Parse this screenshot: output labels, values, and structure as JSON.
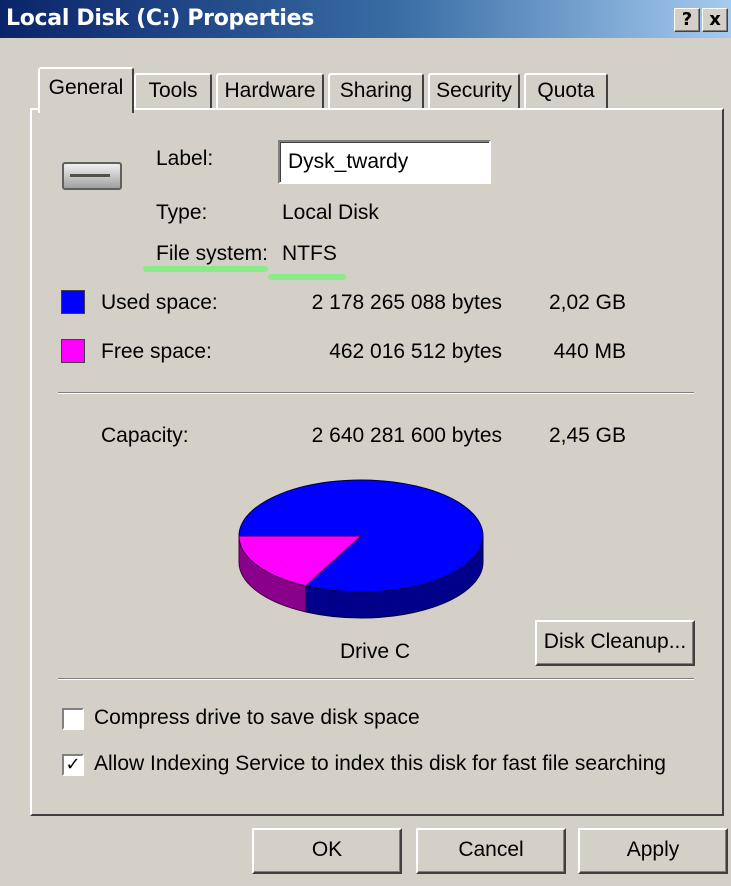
{
  "window": {
    "title": "Local Disk (C:) Properties",
    "help_label": "?",
    "close_label": "x"
  },
  "tabs": [
    {
      "label": "General",
      "active": true
    },
    {
      "label": "Tools"
    },
    {
      "label": "Hardware"
    },
    {
      "label": "Sharing"
    },
    {
      "label": "Security"
    },
    {
      "label": "Quota"
    }
  ],
  "general": {
    "label_caption": "Label:",
    "label_value": "Dysk_twardy",
    "type_caption": "Type:",
    "type_value": "Local Disk",
    "fs_caption": "File system:",
    "fs_value": "NTFS",
    "used_caption": "Used space:",
    "used_bytes": "2 178 265 088 bytes",
    "used_size": "2,02 GB",
    "free_caption": "Free space:",
    "free_bytes": "462 016 512 bytes",
    "free_size": "440 MB",
    "capacity_caption": "Capacity:",
    "capacity_bytes": "2 640 281 600 bytes",
    "capacity_size": "2,45 GB",
    "drive_caption": "Drive C",
    "cleanup_button": "Disk Cleanup...",
    "compress_label": "Compress drive to save disk space",
    "compress_checked": false,
    "index_label": "Allow Indexing Service to index this disk for fast file searching",
    "index_checked": true,
    "used_color": "#0000ff",
    "free_color": "#ff00ff",
    "used_fraction": 0.825,
    "free_fraction": 0.175
  },
  "footer": {
    "ok": "OK",
    "cancel": "Cancel",
    "apply": "Apply"
  }
}
